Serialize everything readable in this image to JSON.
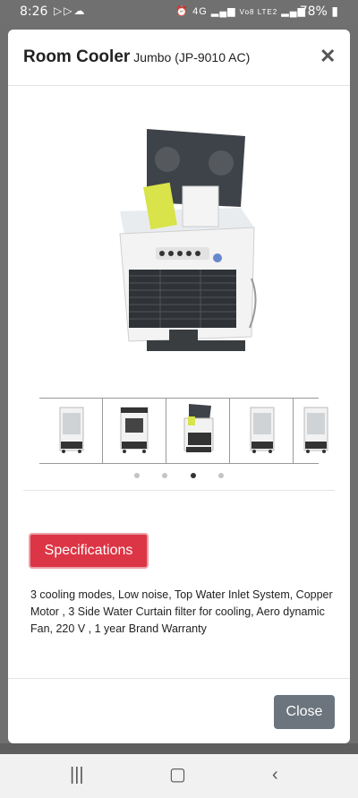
{
  "status_bar": {
    "time": "8:26",
    "battery": "78%",
    "left_icons": [
      "play-store-icon",
      "play-store-icon",
      "cloud-icon"
    ],
    "right_icons": [
      "alarm-icon",
      "4g-signal-icon",
      "volte-icon",
      "signal-icon",
      "battery-icon"
    ],
    "network_label": "4G",
    "volte_label": "Vo8 LTE2"
  },
  "modal": {
    "title": "Room Cooler",
    "subtitle": "Jumbo (JP-9010 AC)",
    "close_icon": "close-icon",
    "image_alt": "room-cooler-product-image",
    "thumbnail_count": 5,
    "active_slide": 3,
    "slides": 4,
    "specifications_label": "Specifications",
    "description": "3 cooling modes, Low noise, Top Water Inlet System, Copper Motor , 3 Side Water Curtain filter for cooling, Aero dynamic Fan, 220 V , 1 year Brand Warranty",
    "close_label": "Close",
    "accent_color": "#dc3545",
    "secondary_color": "#6c757d"
  },
  "nav_bar": {
    "icons": [
      "recent-apps-icon",
      "home-icon",
      "back-icon"
    ]
  }
}
